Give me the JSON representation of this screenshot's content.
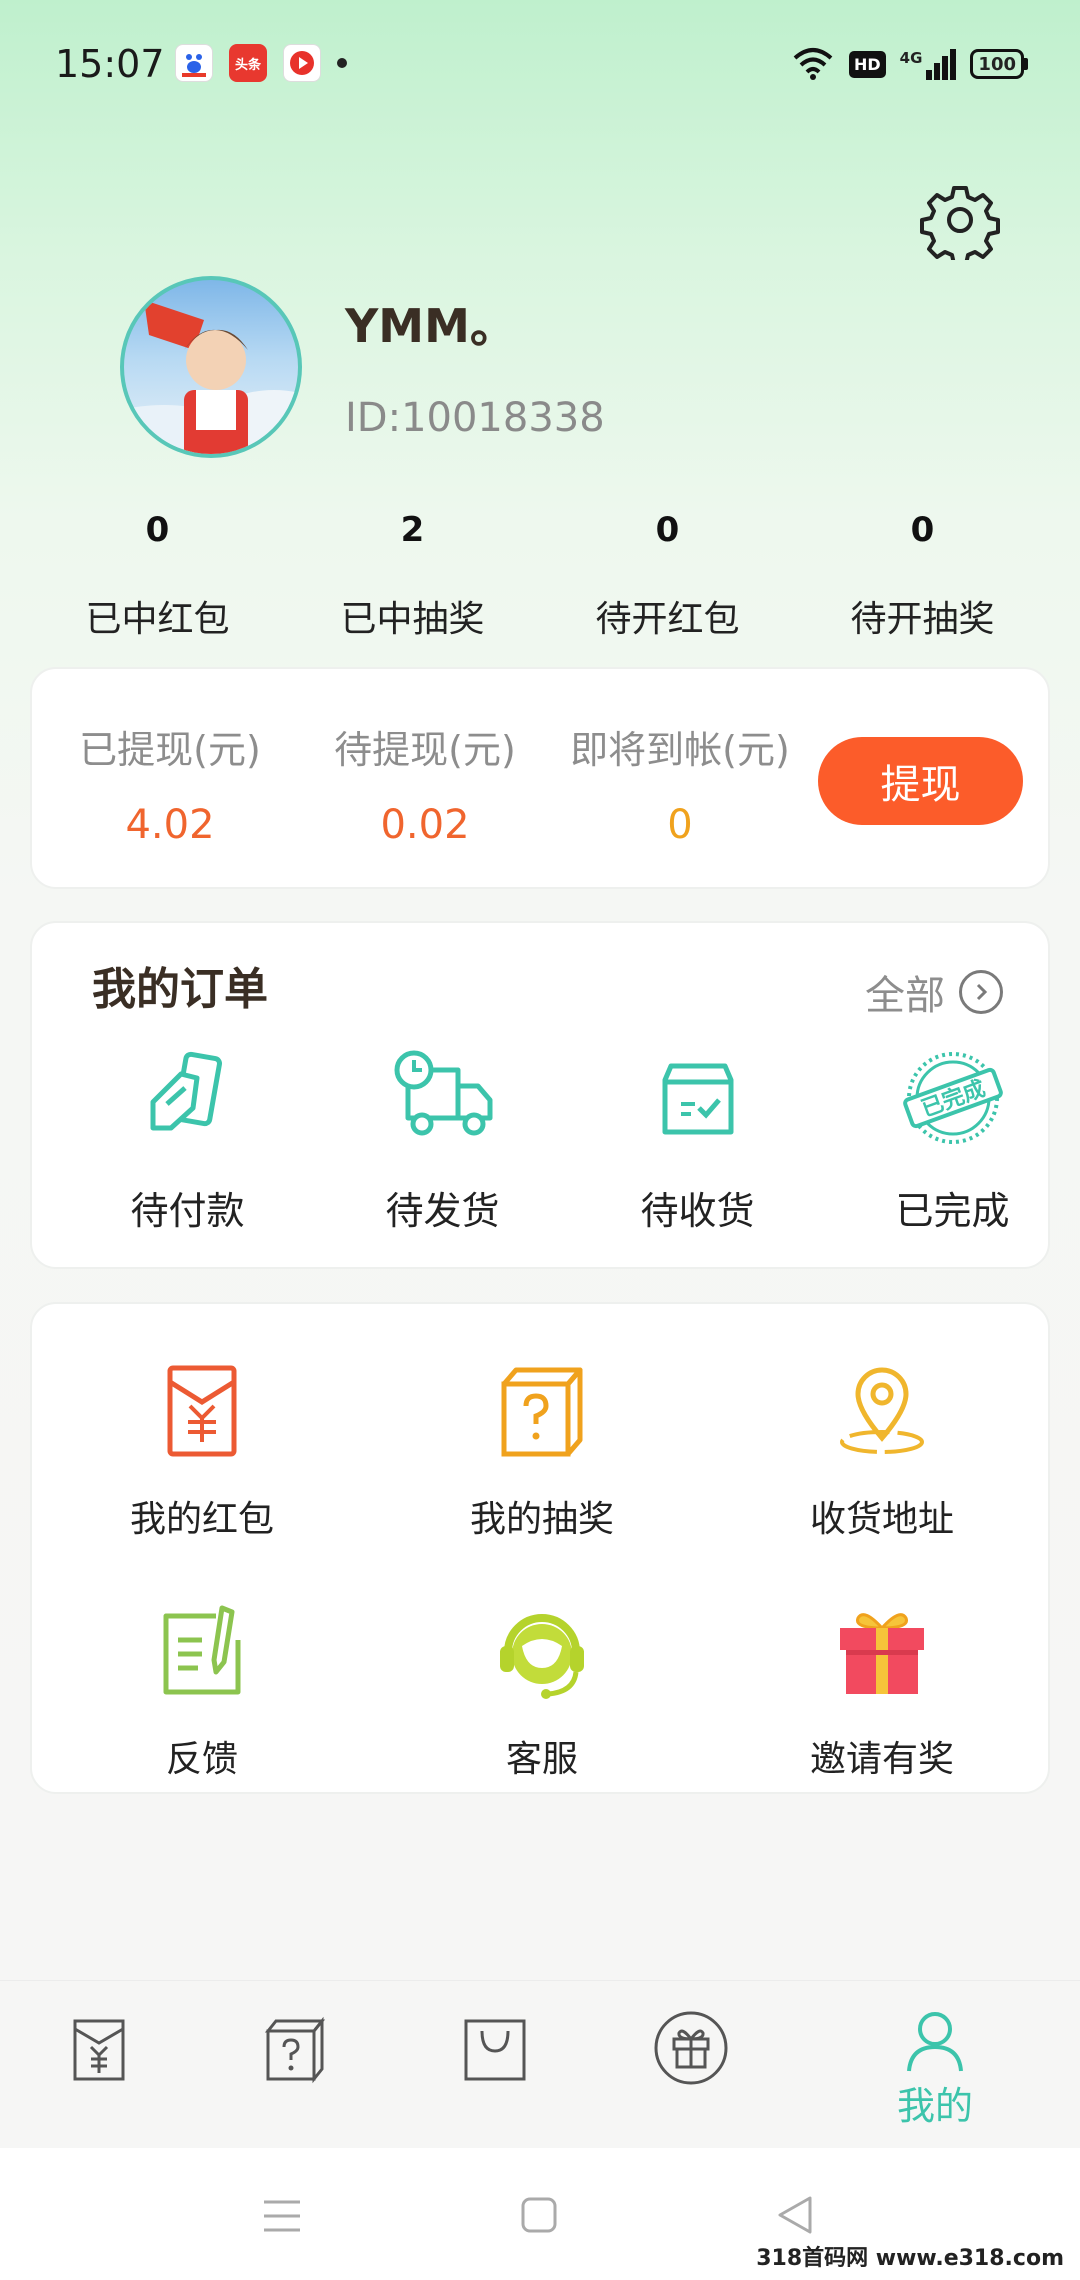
{
  "status_bar": {
    "time": "15:07",
    "apps": [
      "baidu-icon",
      "toutiao-icon",
      "video-icon"
    ],
    "toutiao_label": "头条",
    "hd": "HD",
    "network": "4G",
    "battery": "100"
  },
  "profile": {
    "username": "YMM。",
    "id": "ID:10018338"
  },
  "stats": [
    {
      "value": "0",
      "label": "已中红包"
    },
    {
      "value": "2",
      "label": "已中抽奖"
    },
    {
      "value": "0",
      "label": "待开红包"
    },
    {
      "value": "0",
      "label": "待开抽奖"
    }
  ],
  "wallet": {
    "items": [
      {
        "label": "已提现(元)",
        "value": "4.02",
        "color": "#f0652e"
      },
      {
        "label": "待提现(元)",
        "value": "0.02",
        "color": "#f0652e"
      },
      {
        "label": "即将到帐(元)",
        "value": "0",
        "color": "#f0a21d"
      }
    ],
    "withdraw_label": "提现"
  },
  "orders": {
    "title": "我的订单",
    "all_label": "全部",
    "items": [
      {
        "label": "待付款",
        "icon": "payment-card-icon"
      },
      {
        "label": "待发货",
        "icon": "delivery-truck-icon"
      },
      {
        "label": "待收货",
        "icon": "receive-box-icon"
      },
      {
        "label": "已完成",
        "icon": "completed-stamp-icon"
      }
    ],
    "stamp_text": "已完成"
  },
  "services": {
    "items": [
      {
        "label": "我的红包",
        "icon": "red-envelope-icon"
      },
      {
        "label": "我的抽奖",
        "icon": "mystery-box-icon"
      },
      {
        "label": "收货地址",
        "icon": "location-pin-icon"
      },
      {
        "label": "反馈",
        "icon": "feedback-edit-icon"
      },
      {
        "label": "客服",
        "icon": "customer-service-icon"
      },
      {
        "label": "邀请有奖",
        "icon": "gift-icon"
      }
    ]
  },
  "tabbar": {
    "items": [
      {
        "icon": "red-envelope-tab-icon"
      },
      {
        "icon": "mystery-box-tab-icon"
      },
      {
        "icon": "shopping-bag-tab-icon"
      },
      {
        "icon": "gift-tab-icon"
      },
      {
        "icon": "user-tab-icon",
        "label": "我的",
        "active": true
      }
    ]
  },
  "watermark": "318首码网 www.e318.com",
  "colors": {
    "accent": "#3cc4ab",
    "withdraw_button": "#fc5c2a",
    "money_orange": "#f0652e",
    "money_amber": "#f0a21d"
  }
}
